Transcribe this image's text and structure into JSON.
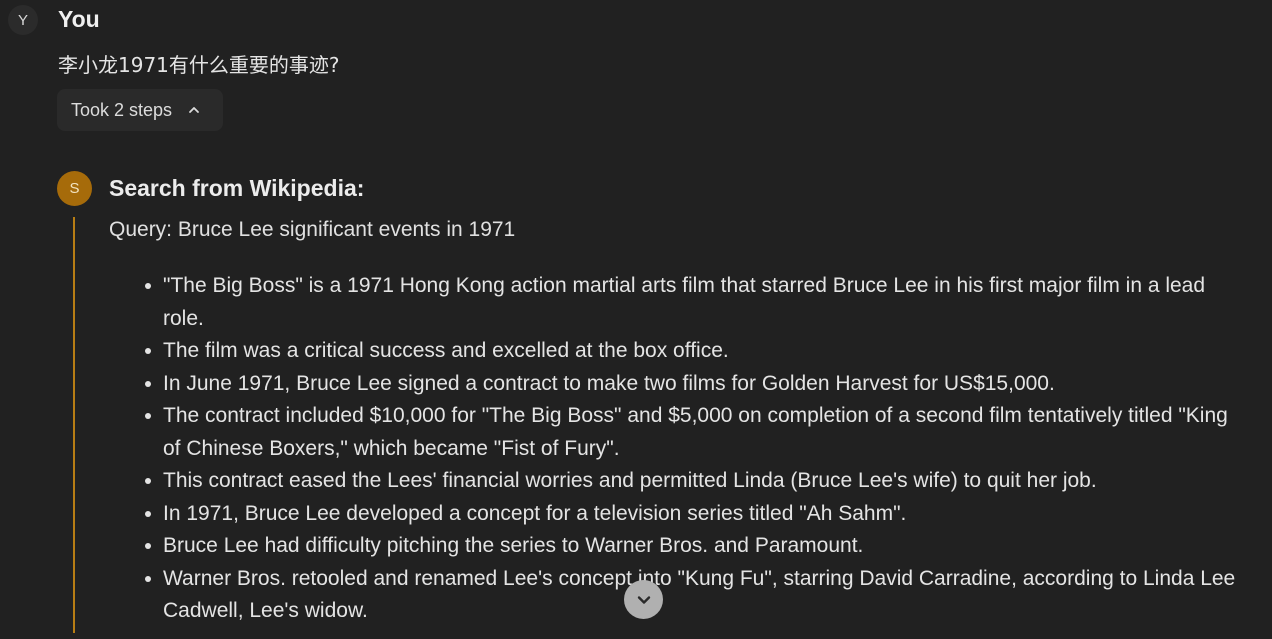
{
  "user": {
    "avatar_letter": "Y",
    "name": "You",
    "message": "李小龙1971有什么重要的事迹?",
    "steps_label": "Took 2 steps"
  },
  "tool_step": {
    "avatar_letter": "S",
    "title": "Search from Wikipedia:",
    "query": "Query: Bruce Lee significant events in 1971",
    "accent_color": "#b77d14",
    "results": [
      "\"The Big Boss\" is a 1971 Hong Kong action martial arts film that starred Bruce Lee in his first major film in a lead role.",
      "The film was a critical success and excelled at the box office.",
      "In June 1971, Bruce Lee signed a contract to make two films for Golden Harvest for US$15,000.",
      "The contract included $10,000 for \"The Big Boss\" and $5,000 on completion of a second film tentatively titled \"King of Chinese Boxers,\" which became \"Fist of Fury\".",
      "This contract eased the Lees' financial worries and permitted Linda (Bruce Lee's wife) to quit her job.",
      "In 1971, Bruce Lee developed a concept for a television series titled \"Ah Sahm\".",
      "Bruce Lee had difficulty pitching the series to Warner Bros. and Paramount.",
      "Warner Bros. retooled and renamed Lee's concept into \"Kung Fu\", starring David Carradine, according to Linda Lee Cadwell, Lee's widow."
    ]
  },
  "icons": {
    "steps_toggle": "chevron-up-icon",
    "scroll": "chevron-down-icon"
  }
}
